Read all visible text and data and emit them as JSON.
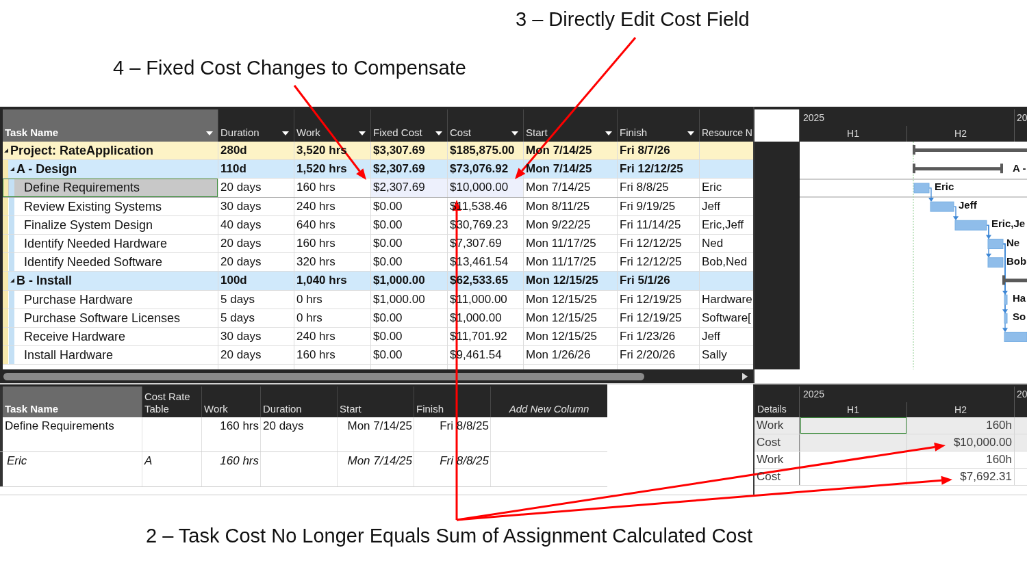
{
  "header_callouts": [
    "3 – Directly Edit Cost Field",
    "4 – Fixed Cost Changes to Compensate"
  ],
  "task_sheet": {
    "name_column": "Task Name",
    "columns": [
      "Duration",
      "Work",
      "Fixed Cost",
      "Cost",
      "Start",
      "Finish",
      "Resource N"
    ],
    "rows": [
      {
        "kind": "project",
        "name": "Project: RateApplication",
        "expanded": true,
        "selected": false,
        "cells": [
          {
            "text": "280d",
            "highlighted": false
          },
          {
            "text": "3,520 hrs",
            "highlighted": false
          },
          {
            "text": "$3,307.69",
            "highlighted": false
          },
          {
            "text": "$185,875.00",
            "highlighted": false
          },
          {
            "text": "Mon 7/14/25",
            "highlighted": false
          },
          {
            "text": "Fri 8/7/26",
            "highlighted": false
          }
        ],
        "children": [
          {
            "kind": "summary",
            "name": "A - Design",
            "expanded": true,
            "selected": false,
            "cells": [
              {
                "text": "110d",
                "highlighted": false
              },
              {
                "text": "1,520 hrs",
                "highlighted": false
              },
              {
                "text": "$2,307.69",
                "highlighted": false
              },
              {
                "text": "$73,076.92",
                "highlighted": false
              },
              {
                "text": "Mon 7/14/25",
                "highlighted": false
              },
              {
                "text": "Fri 12/12/25",
                "highlighted": false
              }
            ],
            "children": [
              {
                "kind": "task",
                "name": "Define Requirements",
                "selected": true,
                "cells": [
                  {
                    "text": "20 days",
                    "highlighted": false
                  },
                  {
                    "text": "160 hrs",
                    "highlighted": false
                  },
                  {
                    "text": "$2,307.69",
                    "highlighted": true
                  },
                  {
                    "text": "$10,000.00",
                    "highlighted": true
                  },
                  {
                    "text": "Mon 7/14/25",
                    "highlighted": false
                  },
                  {
                    "text": "Fri 8/8/25",
                    "highlighted": false
                  },
                  {
                    "text": "Eric",
                    "highlighted": false
                  }
                ]
              },
              {
                "kind": "task",
                "name": "Review Existing Systems",
                "selected": false,
                "cells": [
                  {
                    "text": "30 days",
                    "highlighted": false
                  },
                  {
                    "text": "240 hrs",
                    "highlighted": false
                  },
                  {
                    "text": "$0.00",
                    "highlighted": false
                  },
                  {
                    "text": "$11,538.46",
                    "highlighted": false
                  },
                  {
                    "text": "Mon 8/11/25",
                    "highlighted": false
                  },
                  {
                    "text": "Fri 9/19/25",
                    "highlighted": false
                  },
                  {
                    "text": "Jeff",
                    "highlighted": false
                  }
                ]
              },
              {
                "kind": "task",
                "name": "Finalize System Design",
                "selected": false,
                "cells": [
                  {
                    "text": "40 days",
                    "highlighted": false
                  },
                  {
                    "text": "640 hrs",
                    "highlighted": false
                  },
                  {
                    "text": "$0.00",
                    "highlighted": false
                  },
                  {
                    "text": "$30,769.23",
                    "highlighted": false
                  },
                  {
                    "text": "Mon 9/22/25",
                    "highlighted": false
                  },
                  {
                    "text": "Fri 11/14/25",
                    "highlighted": false
                  },
                  {
                    "text": "Eric,Jeff",
                    "highlighted": false
                  }
                ]
              },
              {
                "kind": "task",
                "name": "Identify Needed Hardware",
                "selected": false,
                "cells": [
                  {
                    "text": "20 days",
                    "highlighted": false
                  },
                  {
                    "text": "160 hrs",
                    "highlighted": false
                  },
                  {
                    "text": "$0.00",
                    "highlighted": false
                  },
                  {
                    "text": "$7,307.69",
                    "highlighted": false
                  },
                  {
                    "text": "Mon 11/17/25",
                    "highlighted": false
                  },
                  {
                    "text": "Fri 12/12/25",
                    "highlighted": false
                  },
                  {
                    "text": "Ned",
                    "highlighted": false
                  }
                ]
              },
              {
                "kind": "task",
                "name": "Identify Needed Software",
                "selected": false,
                "cells": [
                  {
                    "text": "20 days",
                    "highlighted": false
                  },
                  {
                    "text": "320 hrs",
                    "highlighted": false
                  },
                  {
                    "text": "$0.00",
                    "highlighted": false
                  },
                  {
                    "text": "$13,461.54",
                    "highlighted": false
                  },
                  {
                    "text": "Mon 11/17/25",
                    "highlighted": false
                  },
                  {
                    "text": "Fri 12/12/25",
                    "highlighted": false
                  },
                  {
                    "text": "Bob,Ned",
                    "highlighted": false
                  }
                ]
              }
            ]
          },
          {
            "kind": "summary",
            "name": "B - Install",
            "expanded": true,
            "selected": false,
            "cells": [
              {
                "text": "100d",
                "highlighted": false
              },
              {
                "text": "1,040 hrs",
                "highlighted": false
              },
              {
                "text": "$1,000.00",
                "highlighted": false
              },
              {
                "text": "$62,533.65",
                "highlighted": false
              },
              {
                "text": "Mon 12/15/25",
                "highlighted": false
              },
              {
                "text": "Fri 5/1/26",
                "highlighted": false
              }
            ],
            "children": [
              {
                "kind": "task",
                "name": "Purchase Hardware",
                "selected": false,
                "cells": [
                  {
                    "text": "5 days",
                    "highlighted": false
                  },
                  {
                    "text": "0 hrs",
                    "highlighted": false
                  },
                  {
                    "text": "$1,000.00",
                    "highlighted": false
                  },
                  {
                    "text": "$11,000.00",
                    "highlighted": false
                  },
                  {
                    "text": "Mon 12/15/25",
                    "highlighted": false
                  },
                  {
                    "text": "Fri 12/19/25",
                    "highlighted": false
                  },
                  {
                    "text": "Hardware",
                    "highlighted": false
                  }
                ]
              },
              {
                "kind": "task",
                "name": "Purchase Software Licenses",
                "selected": false,
                "cells": [
                  {
                    "text": "5 days",
                    "highlighted": false
                  },
                  {
                    "text": "0 hrs",
                    "highlighted": false
                  },
                  {
                    "text": "$0.00",
                    "highlighted": false
                  },
                  {
                    "text": "$1,000.00",
                    "highlighted": false
                  },
                  {
                    "text": "Mon 12/15/25",
                    "highlighted": false
                  },
                  {
                    "text": "Fri 12/19/25",
                    "highlighted": false
                  },
                  {
                    "text": "Software[",
                    "highlighted": false
                  }
                ]
              },
              {
                "kind": "task",
                "name": "Receive Hardware",
                "selected": false,
                "cells": [
                  {
                    "text": "30 days",
                    "highlighted": false
                  },
                  {
                    "text": "240 hrs",
                    "highlighted": false
                  },
                  {
                    "text": "$0.00",
                    "highlighted": false
                  },
                  {
                    "text": "$11,701.92",
                    "highlighted": false
                  },
                  {
                    "text": "Mon 12/15/25",
                    "highlighted": false
                  },
                  {
                    "text": "Fri 1/23/26",
                    "highlighted": false
                  },
                  {
                    "text": "Jeff",
                    "highlighted": false
                  }
                ]
              },
              {
                "kind": "task",
                "name": "Install Hardware",
                "selected": false,
                "cells": [
                  {
                    "text": "20 days",
                    "highlighted": false
                  },
                  {
                    "text": "160 hrs",
                    "highlighted": false
                  },
                  {
                    "text": "$0.00",
                    "highlighted": false
                  },
                  {
                    "text": "$9,461.54",
                    "highlighted": false
                  },
                  {
                    "text": "Mon 1/26/26",
                    "highlighted": false
                  },
                  {
                    "text": "Fri 2/20/26",
                    "highlighted": false
                  },
                  {
                    "text": "Sally",
                    "highlighted": false
                  }
                ]
              }
            ]
          }
        ]
      }
    ]
  },
  "gantt": {
    "timescale": {
      "years": [
        "2025",
        "20"
      ],
      "halves": [
        "H1",
        "H2"
      ]
    },
    "bars": [
      {
        "kind": "summary"
      },
      {
        "kind": "summary",
        "label": "A -"
      },
      {
        "kind": "task",
        "label": "Eric"
      },
      {
        "kind": "task",
        "label": "Jeff"
      },
      {
        "kind": "task",
        "label": "Eric,Je"
      },
      {
        "kind": "task",
        "label": "Ne"
      },
      {
        "kind": "task",
        "label": "Bob"
      },
      {
        "kind": "summary"
      },
      {
        "kind": "task",
        "label": "Ha"
      },
      {
        "kind": "task",
        "label": "So"
      },
      {
        "kind": "task"
      }
    ]
  },
  "assignment_form": {
    "columns": [
      "Task Name",
      "Cost Rate Table",
      "Work",
      "Duration",
      "Start",
      "Finish",
      "Add New Column"
    ],
    "rows": [
      {
        "kind": "task",
        "cells": [
          "Define Requirements",
          null,
          "160 hrs",
          "20 days",
          "Mon 7/14/25",
          "Fri 8/8/25"
        ]
      },
      {
        "kind": "assignment",
        "cells": [
          "Eric",
          "A",
          "160 hrs",
          null,
          "Mon 7/14/25",
          "Fri 8/8/25"
        ]
      }
    ]
  },
  "usage_grid": {
    "heading": "Details",
    "timescale": {
      "years": [
        "2025",
        "20"
      ],
      "halves": [
        "H1",
        "H2"
      ]
    },
    "rows": [
      {
        "kind": "task",
        "detail": "Work",
        "cells": [
          {
            "selected": true
          },
          {
            "text": "160h",
            "selected": false
          }
        ]
      },
      {
        "kind": "task",
        "detail": "Cost",
        "cells": [
          {
            "selected": false
          },
          {
            "text": "$10,000.00",
            "selected": false
          }
        ]
      },
      {
        "kind": "assignment",
        "detail": "Work",
        "cells": [
          {
            "selected": false
          },
          {
            "text": "160h",
            "selected": false
          }
        ]
      },
      {
        "kind": "assignment",
        "detail": "Cost",
        "cells": [
          {
            "selected": false
          },
          {
            "text": "$7,692.31",
            "selected": false
          }
        ]
      }
    ]
  },
  "footer_callout": "2 – Task Cost No Longer Equals Sum of Assignment Calculated Cost"
}
